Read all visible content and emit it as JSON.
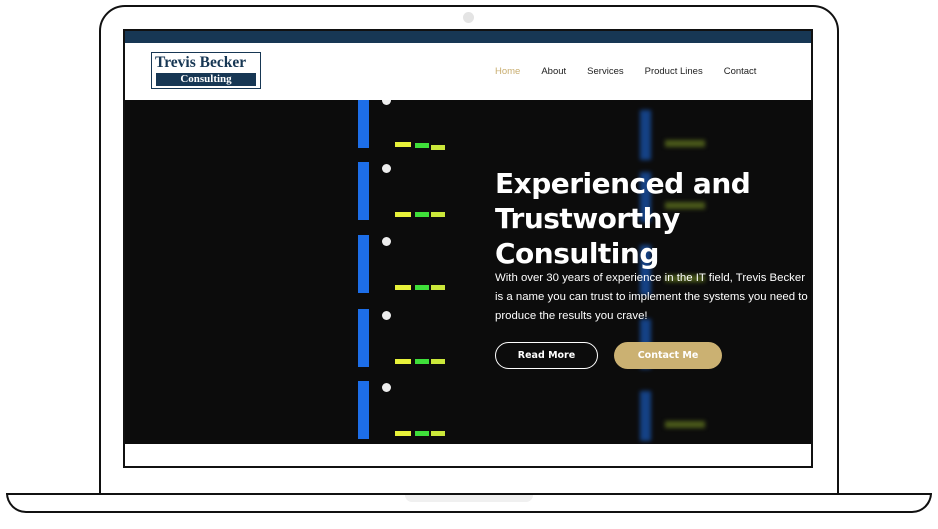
{
  "logo": {
    "line1": "Trevis Becker",
    "line2": "Consulting"
  },
  "nav": {
    "items": [
      {
        "label": "Home",
        "active": true
      },
      {
        "label": "About"
      },
      {
        "label": "Services"
      },
      {
        "label": "Product Lines"
      },
      {
        "label": "Contact"
      }
    ]
  },
  "hero": {
    "title": "Experienced and Trustworthy Consulting",
    "text": "With over 30 years of experience in the IT field, Trevis Becker is a name you can trust to implement the systems you need to produce the results you crave!",
    "read_more": "Read More",
    "contact_me": "Contact Me"
  },
  "colors": {
    "brand": "#173754",
    "accent": "#c9ae70"
  }
}
